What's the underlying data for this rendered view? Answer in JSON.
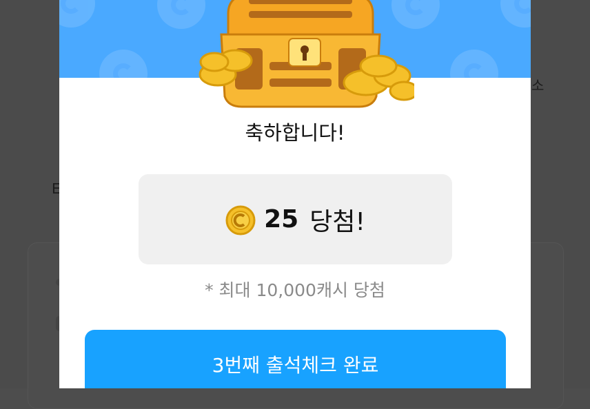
{
  "background": {
    "snippet_right": "소",
    "snippet_left": "E"
  },
  "modal": {
    "congrats": "축하합니다!",
    "prize": {
      "amount": "25",
      "suffix": "당첨!",
      "icon": "coin-icon"
    },
    "note": "* 최대 10,000캐시 당첨",
    "button_label": "3번째 출석체크 완료",
    "banner_icon": "treasure-chest-icon"
  },
  "colors": {
    "banner": "#4aa9ff",
    "button": "#18a2ff",
    "prize_box": "#f0f0f0",
    "coin": "#f5c02a"
  }
}
